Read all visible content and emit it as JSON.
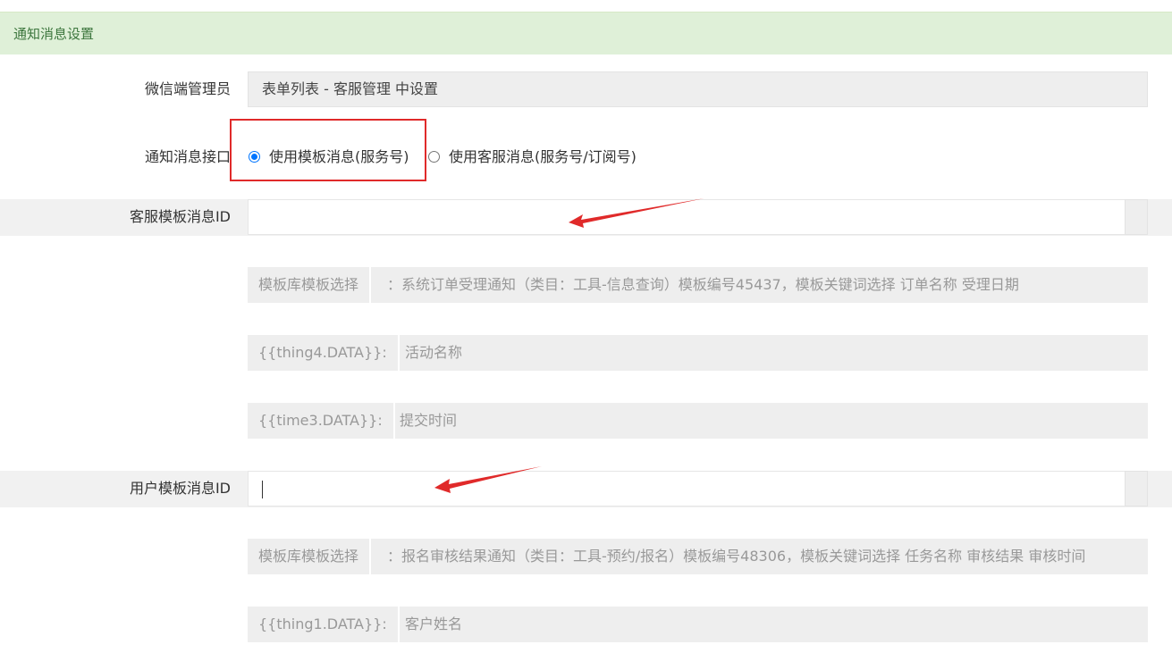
{
  "section": {
    "title": "通知消息设置"
  },
  "wechat_admin": {
    "label": "微信端管理员",
    "value": "表单列表 - 客服管理 中设置"
  },
  "notify_interface": {
    "label": "通知消息接口",
    "options": [
      {
        "label": "使用模板消息(服务号)",
        "selected": true
      },
      {
        "label": "使用客服消息(服务号/订阅号)",
        "selected": false
      }
    ]
  },
  "service_template": {
    "label": "客服模板消息ID",
    "value": "",
    "library": {
      "addon": "模板库模板选择",
      "text": "：系统订单受理通知（类目：工具-信息查询）模板编号45437，模板关键词选择 订单名称 受理日期"
    },
    "fields": [
      {
        "key": "{{thing4.DATA}}:",
        "value": "活动名称"
      },
      {
        "key": "{{time3.DATA}}:",
        "value": "提交时间"
      }
    ]
  },
  "user_template": {
    "label": "用户模板消息ID",
    "value": "",
    "library": {
      "addon": "模板库模板选择",
      "text": "：报名审核结果通知（类目：工具-预约/报名）模板编号48306，模板关键词选择 任务名称 审核结果 审核时间"
    },
    "fields": [
      {
        "key": "{{thing1.DATA}}:",
        "value": "客户姓名"
      }
    ]
  },
  "colors": {
    "header_bg": "#dff0d8",
    "header_text": "#3c763d",
    "annotation_red": "#e02a2a",
    "radio_blue": "#0075ff"
  }
}
